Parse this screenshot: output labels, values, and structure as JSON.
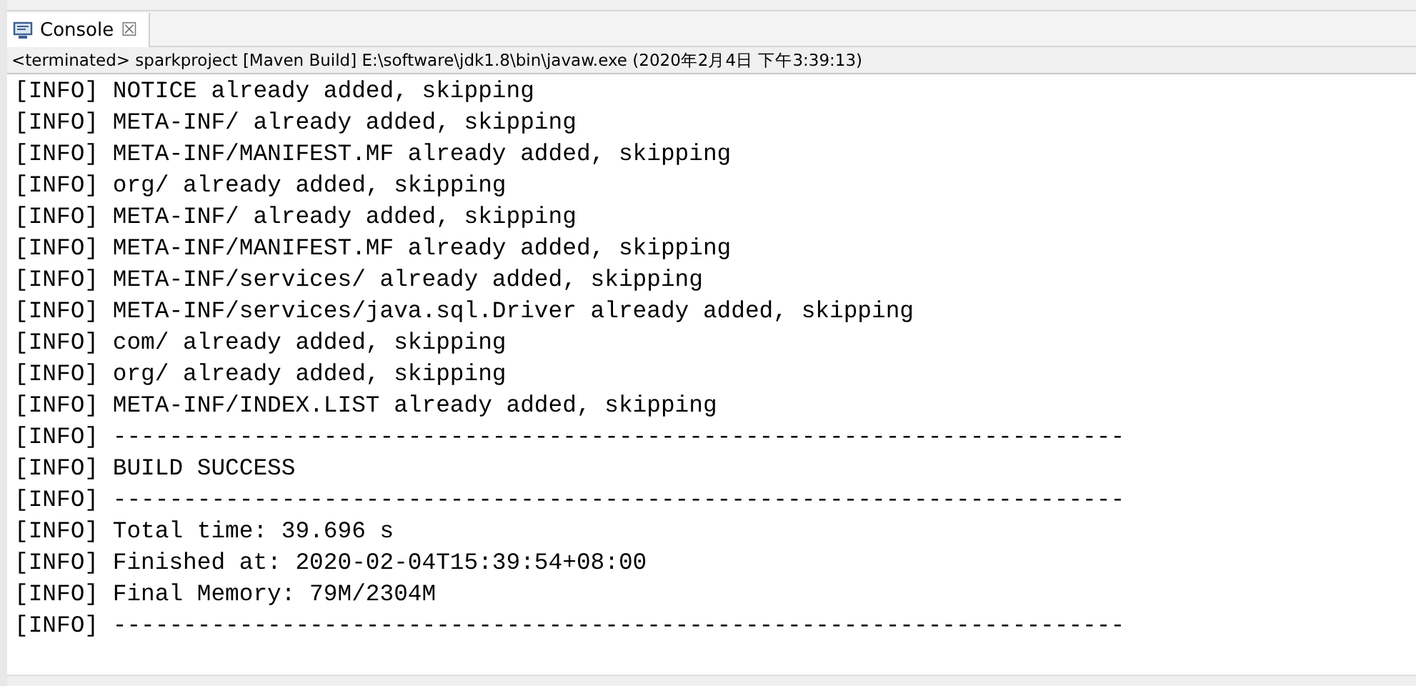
{
  "tab": {
    "label": "Console",
    "close": "☒"
  },
  "header": "<terminated> sparkproject [Maven Build] E:\\software\\jdk1.8\\bin\\javaw.exe (2020年2月4日 下午3:39:13)",
  "lines": [
    "[INFO] NOTICE already added, skipping",
    "[INFO] META-INF/ already added, skipping",
    "[INFO] META-INF/MANIFEST.MF already added, skipping",
    "[INFO] org/ already added, skipping",
    "[INFO] META-INF/ already added, skipping",
    "[INFO] META-INF/MANIFEST.MF already added, skipping",
    "[INFO] META-INF/services/ already added, skipping",
    "[INFO] META-INF/services/java.sql.Driver already added, skipping",
    "[INFO] com/ already added, skipping",
    "[INFO] org/ already added, skipping",
    "[INFO] META-INF/INDEX.LIST already added, skipping",
    "[INFO] ------------------------------------------------------------------------",
    "[INFO] BUILD SUCCESS",
    "[INFO] ------------------------------------------------------------------------",
    "[INFO] Total time: 39.696 s",
    "[INFO] Finished at: 2020-02-04T15:39:54+08:00",
    "[INFO] Final Memory: 79M/2304M",
    "[INFO] ------------------------------------------------------------------------"
  ]
}
